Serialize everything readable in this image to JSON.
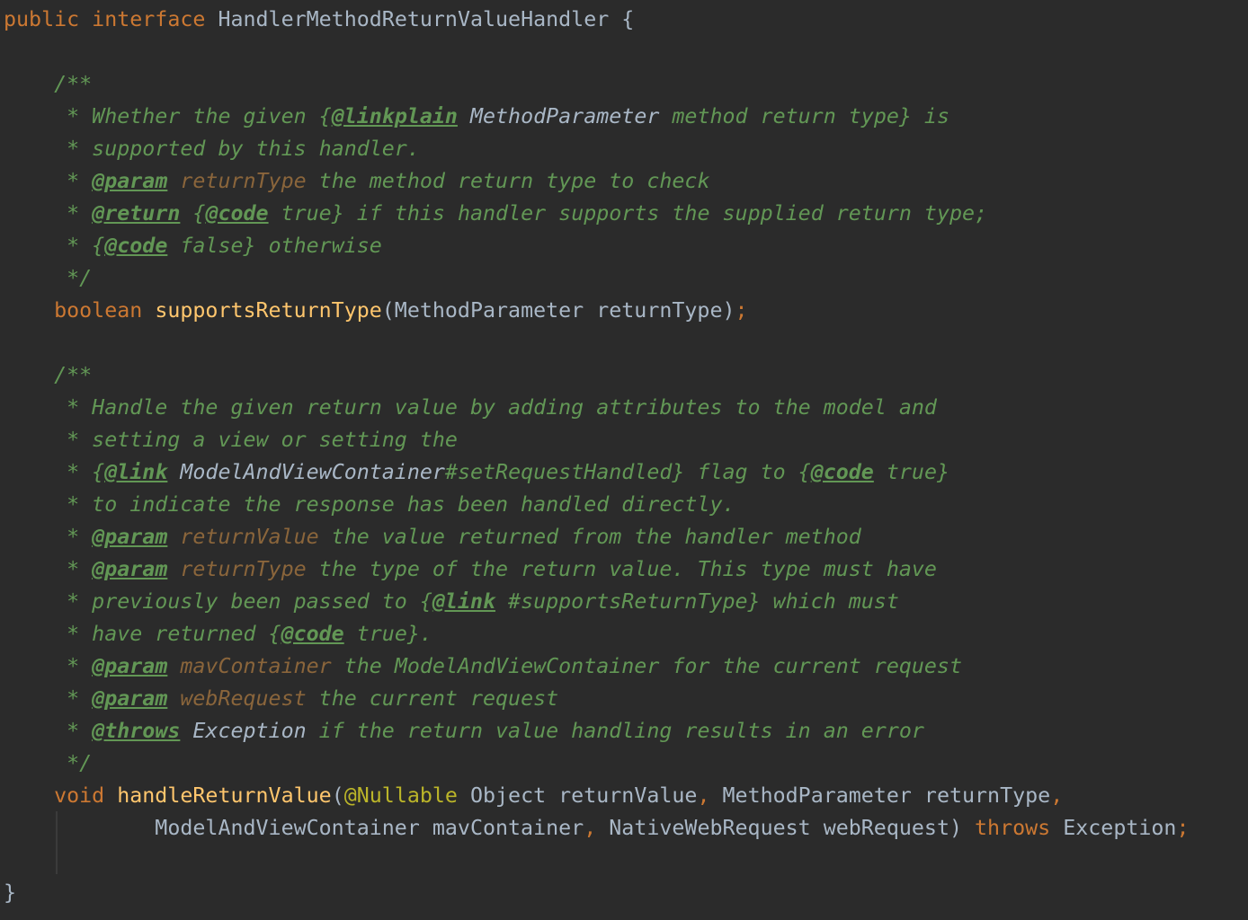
{
  "lines": [
    [
      [
        "kw",
        "public interface "
      ],
      [
        "pl",
        "HandlerMethodReturnValueHandler {"
      ]
    ],
    [],
    [
      [
        "doc",
        "    /**"
      ]
    ],
    [
      [
        "doc",
        "     * Whether the given {"
      ],
      [
        "tag",
        "@linkplain"
      ],
      [
        "ref",
        " MethodParameter"
      ],
      [
        "doc",
        " method return type} is"
      ]
    ],
    [
      [
        "doc",
        "     * supported by this handler."
      ]
    ],
    [
      [
        "doc",
        "     * "
      ],
      [
        "tag",
        "@param"
      ],
      [
        "prm",
        " returnType"
      ],
      [
        "doc",
        " the method return type to check"
      ]
    ],
    [
      [
        "doc",
        "     * "
      ],
      [
        "tag",
        "@return"
      ],
      [
        "doc",
        " {"
      ],
      [
        "tag",
        "@code"
      ],
      [
        "doc",
        " true} if this handler supports the supplied return type;"
      ]
    ],
    [
      [
        "doc",
        "     * {"
      ],
      [
        "tag",
        "@code"
      ],
      [
        "doc",
        " false} otherwise"
      ]
    ],
    [
      [
        "doc",
        "     */"
      ]
    ],
    [
      [
        "kw",
        "    boolean "
      ],
      [
        "fn",
        "supportsReturnType"
      ],
      [
        "pl",
        "(MethodParameter returnType)"
      ],
      [
        "kw",
        ";"
      ]
    ],
    [],
    [
      [
        "doc",
        "    /**"
      ]
    ],
    [
      [
        "doc",
        "     * Handle the given return value by adding attributes to the model and"
      ]
    ],
    [
      [
        "doc",
        "     * setting a view or setting the"
      ]
    ],
    [
      [
        "doc",
        "     * {"
      ],
      [
        "tag",
        "@link"
      ],
      [
        "ref",
        " ModelAndViewContainer"
      ],
      [
        "doc",
        "#setRequestHandled} flag to {"
      ],
      [
        "tag",
        "@code"
      ],
      [
        "doc",
        " true}"
      ]
    ],
    [
      [
        "doc",
        "     * to indicate the response has been handled directly."
      ]
    ],
    [
      [
        "doc",
        "     * "
      ],
      [
        "tag",
        "@param"
      ],
      [
        "prm",
        " returnValue"
      ],
      [
        "doc",
        " the value returned from the handler method"
      ]
    ],
    [
      [
        "doc",
        "     * "
      ],
      [
        "tag",
        "@param"
      ],
      [
        "prm",
        " returnType"
      ],
      [
        "doc",
        " the type of the return value. This type must have"
      ]
    ],
    [
      [
        "doc",
        "     * previously been passed to {"
      ],
      [
        "tag",
        "@link"
      ],
      [
        "doc",
        " #supportsReturnType} which must"
      ]
    ],
    [
      [
        "doc",
        "     * have returned {"
      ],
      [
        "tag",
        "@code"
      ],
      [
        "doc",
        " true}."
      ]
    ],
    [
      [
        "doc",
        "     * "
      ],
      [
        "tag",
        "@param"
      ],
      [
        "prm",
        " mavContainer"
      ],
      [
        "doc",
        " the ModelAndViewContainer for the current request"
      ]
    ],
    [
      [
        "doc",
        "     * "
      ],
      [
        "tag",
        "@param"
      ],
      [
        "prm",
        " webRequest"
      ],
      [
        "doc",
        " the current request"
      ]
    ],
    [
      [
        "doc",
        "     * "
      ],
      [
        "tag",
        "@throws"
      ],
      [
        "ref",
        " Exception"
      ],
      [
        "doc",
        " if the return value handling results in an error"
      ]
    ],
    [
      [
        "doc",
        "     */"
      ]
    ],
    [
      [
        "kw",
        "    void "
      ],
      [
        "fn",
        "handleReturnValue"
      ],
      [
        "pl",
        "("
      ],
      [
        "ann",
        "@Nullable"
      ],
      [
        "pl",
        " Object returnValue"
      ],
      [
        "kw",
        ", "
      ],
      [
        "pl",
        "MethodParameter returnType"
      ],
      [
        "kw",
        ","
      ]
    ],
    [
      [
        "pl",
        "            ModelAndViewContainer mavContainer"
      ],
      [
        "kw",
        ", "
      ],
      [
        "pl",
        "NativeWebRequest webRequest) "
      ],
      [
        "kw",
        "throws "
      ],
      [
        "pl",
        "Exception"
      ],
      [
        "kw",
        ";"
      ]
    ],
    [],
    [
      [
        "pl",
        "}"
      ]
    ]
  ]
}
